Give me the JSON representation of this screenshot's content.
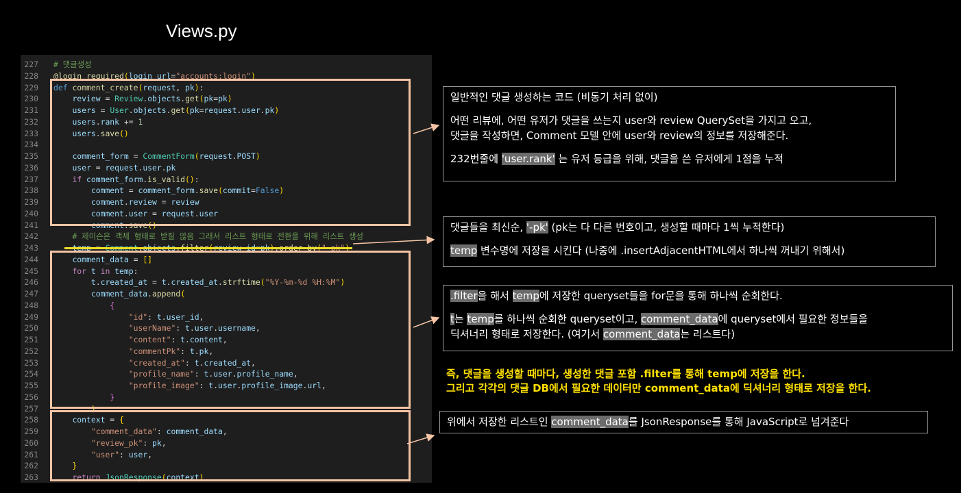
{
  "title": "Views.py",
  "code_lines": [
    {
      "n": "227",
      "i": 1,
      "t": [
        [
          "cmt",
          "# 댓글생성"
        ]
      ]
    },
    {
      "n": "228",
      "i": 1,
      "t": [
        [
          "fn",
          "@login_required"
        ],
        [
          "br1",
          "("
        ],
        [
          "var",
          "login_url"
        ],
        [
          "plain",
          "="
        ],
        [
          "str",
          "\"accounts:login\""
        ],
        [
          "br1",
          ")"
        ]
      ]
    },
    {
      "n": "229",
      "i": 0,
      "t": [
        [
          "kw",
          "def "
        ],
        [
          "fn",
          "comment_create"
        ],
        [
          "br1",
          "("
        ],
        [
          "var",
          "request"
        ],
        [
          "plain",
          ", "
        ],
        [
          "var",
          "pk"
        ],
        [
          "br1",
          ")"
        ],
        [
          "plain",
          ":"
        ]
      ]
    },
    {
      "n": "230",
      "i": 2,
      "t": [
        [
          "var",
          "review"
        ],
        [
          "plain",
          " = "
        ],
        [
          "cls",
          "Review"
        ],
        [
          "plain",
          "."
        ],
        [
          "var",
          "objects"
        ],
        [
          "plain",
          "."
        ],
        [
          "fn",
          "get"
        ],
        [
          "br1",
          "("
        ],
        [
          "var",
          "pk"
        ],
        [
          "plain",
          "="
        ],
        [
          "var",
          "pk"
        ],
        [
          "br1",
          ")"
        ]
      ]
    },
    {
      "n": "231",
      "i": 2,
      "t": [
        [
          "var",
          "users"
        ],
        [
          "plain",
          " = "
        ],
        [
          "cls",
          "User"
        ],
        [
          "plain",
          "."
        ],
        [
          "var",
          "objects"
        ],
        [
          "plain",
          "."
        ],
        [
          "fn",
          "get"
        ],
        [
          "br1",
          "("
        ],
        [
          "var",
          "pk"
        ],
        [
          "plain",
          "="
        ],
        [
          "var",
          "request"
        ],
        [
          "plain",
          "."
        ],
        [
          "var",
          "user"
        ],
        [
          "plain",
          "."
        ],
        [
          "var",
          "pk"
        ],
        [
          "br1",
          ")"
        ]
      ]
    },
    {
      "n": "232",
      "i": 2,
      "t": [
        [
          "var",
          "users"
        ],
        [
          "plain",
          "."
        ],
        [
          "var",
          "rank"
        ],
        [
          "plain",
          " += "
        ],
        [
          "num",
          "1"
        ]
      ]
    },
    {
      "n": "233",
      "i": 2,
      "t": [
        [
          "var",
          "users"
        ],
        [
          "plain",
          "."
        ],
        [
          "fn",
          "save"
        ],
        [
          "br1",
          "()"
        ]
      ]
    },
    {
      "n": "234",
      "i": 0,
      "t": []
    },
    {
      "n": "235",
      "i": 2,
      "t": [
        [
          "var",
          "comment_form"
        ],
        [
          "plain",
          " = "
        ],
        [
          "cls",
          "CommentForm"
        ],
        [
          "br1",
          "("
        ],
        [
          "var",
          "request"
        ],
        [
          "plain",
          "."
        ],
        [
          "var",
          "POST"
        ],
        [
          "br1",
          ")"
        ]
      ]
    },
    {
      "n": "236",
      "i": 2,
      "t": [
        [
          "var",
          "user"
        ],
        [
          "plain",
          " = "
        ],
        [
          "var",
          "request"
        ],
        [
          "plain",
          "."
        ],
        [
          "var",
          "user"
        ],
        [
          "plain",
          "."
        ],
        [
          "var",
          "pk"
        ]
      ]
    },
    {
      "n": "237",
      "i": 2,
      "t": [
        [
          "kw2",
          "if "
        ],
        [
          "var",
          "comment_form"
        ],
        [
          "plain",
          "."
        ],
        [
          "fn",
          "is_valid"
        ],
        [
          "br1",
          "()"
        ],
        [
          "plain",
          ":"
        ]
      ]
    },
    {
      "n": "238",
      "i": 3,
      "t": [
        [
          "var",
          "comment"
        ],
        [
          "plain",
          " = "
        ],
        [
          "var",
          "comment_form"
        ],
        [
          "plain",
          "."
        ],
        [
          "fn",
          "save"
        ],
        [
          "br1",
          "("
        ],
        [
          "var",
          "commit"
        ],
        [
          "plain",
          "="
        ],
        [
          "kw",
          "False"
        ],
        [
          "br1",
          ")"
        ]
      ]
    },
    {
      "n": "239",
      "i": 3,
      "t": [
        [
          "var",
          "comment"
        ],
        [
          "plain",
          "."
        ],
        [
          "var",
          "review"
        ],
        [
          "plain",
          " = "
        ],
        [
          "var",
          "review"
        ]
      ]
    },
    {
      "n": "240",
      "i": 3,
      "t": [
        [
          "var",
          "comment"
        ],
        [
          "plain",
          "."
        ],
        [
          "var",
          "user"
        ],
        [
          "plain",
          " = "
        ],
        [
          "var",
          "request"
        ],
        [
          "plain",
          "."
        ],
        [
          "var",
          "user"
        ]
      ]
    },
    {
      "n": "241",
      "i": 3,
      "t": [
        [
          "var",
          "comment"
        ],
        [
          "plain",
          "."
        ],
        [
          "fn",
          "save"
        ],
        [
          "br1",
          "()"
        ]
      ]
    },
    {
      "n": "242",
      "i": 2,
      "t": [
        [
          "cmt",
          "# 제이슨은 객체 형태로 받질 않음 그래서 리스트 형태로 전환을 위해 리스트 생성"
        ]
      ]
    },
    {
      "n": "243",
      "i": 2,
      "t": [
        [
          "var",
          "temp"
        ],
        [
          "plain",
          " = "
        ],
        [
          "cls",
          "Comment"
        ],
        [
          "plain",
          "."
        ],
        [
          "var",
          "objects"
        ],
        [
          "plain",
          "."
        ],
        [
          "fn",
          "filter"
        ],
        [
          "br1",
          "("
        ],
        [
          "var",
          "review_id"
        ],
        [
          "plain",
          "="
        ],
        [
          "var",
          "pk"
        ],
        [
          "br1",
          ")"
        ],
        [
          "plain",
          "."
        ],
        [
          "fn",
          "order_by"
        ],
        [
          "br1",
          "("
        ],
        [
          "str",
          "\"-pk\""
        ],
        [
          "br1",
          ")"
        ]
      ]
    },
    {
      "n": "244",
      "i": 2,
      "t": [
        [
          "var",
          "comment_data"
        ],
        [
          "plain",
          " = "
        ],
        [
          "br1",
          "[]"
        ]
      ]
    },
    {
      "n": "245",
      "i": 2,
      "t": [
        [
          "kw2",
          "for "
        ],
        [
          "var",
          "t"
        ],
        [
          "kw2",
          " in "
        ],
        [
          "var",
          "temp"
        ],
        [
          "plain",
          ":"
        ]
      ]
    },
    {
      "n": "246",
      "i": 3,
      "t": [
        [
          "var",
          "t"
        ],
        [
          "plain",
          "."
        ],
        [
          "var",
          "created_at"
        ],
        [
          "plain",
          " = "
        ],
        [
          "var",
          "t"
        ],
        [
          "plain",
          "."
        ],
        [
          "var",
          "created_at"
        ],
        [
          "plain",
          "."
        ],
        [
          "fn",
          "strftime"
        ],
        [
          "br1",
          "("
        ],
        [
          "str",
          "\"%Y-%m-%d %H:%M\""
        ],
        [
          "br1",
          ")"
        ]
      ]
    },
    {
      "n": "247",
      "i": 3,
      "t": [
        [
          "var",
          "comment_data"
        ],
        [
          "plain",
          "."
        ],
        [
          "fn",
          "append"
        ],
        [
          "br1",
          "("
        ]
      ]
    },
    {
      "n": "248",
      "i": 4,
      "t": [
        [
          "br2",
          "{"
        ]
      ]
    },
    {
      "n": "249",
      "i": 5,
      "t": [
        [
          "str",
          "\"id\""
        ],
        [
          "plain",
          ": "
        ],
        [
          "var",
          "t"
        ],
        [
          "plain",
          "."
        ],
        [
          "var",
          "user_id"
        ],
        [
          "plain",
          ","
        ]
      ]
    },
    {
      "n": "250",
      "i": 5,
      "t": [
        [
          "str",
          "\"userName\""
        ],
        [
          "plain",
          ": "
        ],
        [
          "var",
          "t"
        ],
        [
          "plain",
          "."
        ],
        [
          "var",
          "user"
        ],
        [
          "plain",
          "."
        ],
        [
          "var",
          "username"
        ],
        [
          "plain",
          ","
        ]
      ]
    },
    {
      "n": "251",
      "i": 5,
      "t": [
        [
          "str",
          "\"content\""
        ],
        [
          "plain",
          ": "
        ],
        [
          "var",
          "t"
        ],
        [
          "plain",
          "."
        ],
        [
          "var",
          "content"
        ],
        [
          "plain",
          ","
        ]
      ]
    },
    {
      "n": "252",
      "i": 5,
      "t": [
        [
          "str",
          "\"commentPk\""
        ],
        [
          "plain",
          ": "
        ],
        [
          "var",
          "t"
        ],
        [
          "plain",
          "."
        ],
        [
          "var",
          "pk"
        ],
        [
          "plain",
          ","
        ]
      ]
    },
    {
      "n": "253",
      "i": 5,
      "t": [
        [
          "str",
          "\"created_at\""
        ],
        [
          "plain",
          ": "
        ],
        [
          "var",
          "t"
        ],
        [
          "plain",
          "."
        ],
        [
          "var",
          "created_at"
        ],
        [
          "plain",
          ","
        ]
      ]
    },
    {
      "n": "254",
      "i": 5,
      "t": [
        [
          "str",
          "\"profile_name\""
        ],
        [
          "plain",
          ": "
        ],
        [
          "var",
          "t"
        ],
        [
          "plain",
          "."
        ],
        [
          "var",
          "user"
        ],
        [
          "plain",
          "."
        ],
        [
          "var",
          "profile_name"
        ],
        [
          "plain",
          ","
        ]
      ]
    },
    {
      "n": "255",
      "i": 5,
      "t": [
        [
          "str",
          "\"profile_image\""
        ],
        [
          "plain",
          ": "
        ],
        [
          "var",
          "t"
        ],
        [
          "plain",
          "."
        ],
        [
          "var",
          "user"
        ],
        [
          "plain",
          "."
        ],
        [
          "var",
          "profile_image"
        ],
        [
          "plain",
          "."
        ],
        [
          "var",
          "url"
        ],
        [
          "plain",
          ","
        ]
      ]
    },
    {
      "n": "256",
      "i": 4,
      "t": [
        [
          "br2",
          "}"
        ]
      ]
    },
    {
      "n": "257",
      "i": 3,
      "t": [
        [
          "br1",
          ")"
        ]
      ]
    },
    {
      "n": "258",
      "i": 2,
      "t": [
        [
          "var",
          "context"
        ],
        [
          "plain",
          " = "
        ],
        [
          "br1",
          "{"
        ]
      ]
    },
    {
      "n": "259",
      "i": 3,
      "t": [
        [
          "str",
          "\"comment_data\""
        ],
        [
          "plain",
          ": "
        ],
        [
          "var",
          "comment_data"
        ],
        [
          "plain",
          ","
        ]
      ]
    },
    {
      "n": "260",
      "i": 3,
      "t": [
        [
          "str",
          "\"review_pk\""
        ],
        [
          "plain",
          ": "
        ],
        [
          "var",
          "pk"
        ],
        [
          "plain",
          ","
        ]
      ]
    },
    {
      "n": "261",
      "i": 3,
      "t": [
        [
          "str",
          "\"user\""
        ],
        [
          "plain",
          ": "
        ],
        [
          "var",
          "user"
        ],
        [
          "plain",
          ","
        ]
      ]
    },
    {
      "n": "262",
      "i": 2,
      "t": [
        [
          "br1",
          "}"
        ]
      ]
    },
    {
      "n": "263",
      "i": 2,
      "t": [
        [
          "kw2",
          "return "
        ],
        [
          "cls",
          "JsonResponse"
        ],
        [
          "br1",
          "("
        ],
        [
          "var",
          "context"
        ],
        [
          "br1",
          ")"
        ]
      ]
    }
  ],
  "notes": {
    "n1": {
      "l1": "일반적인 댓글 생성하는 코드 (비동기 처리 없이)",
      "l2": "어떤 리뷰에, 어떤 유저가 댓글을 쓰는지 user와 review QuerySet을 가지고 오고,",
      "l3": "댓글을 작성하면, Comment 모델 안에 user와 review의 정보를 저장해준다.",
      "l4a": "232번줄에 ",
      "l4tag": "'user.rank'",
      "l4b": " 는 유저 등급을 위해, 댓글을 쓴 유저에게 1점을 누적"
    },
    "n2": {
      "l1a": "댓글들을 최신순, ",
      "l1tag": "'-pk'",
      "l1b": " (pk는 다 다른 번호이고, 생성할 때마다 1씩 누적한다)",
      "l2tag": "temp",
      "l2b": " 변수명에 저장을 시킨다 (나중에 .insertAdjacentHTML에서 하나씩 꺼내기 위해서)"
    },
    "n3": {
      "l1tag": ".filter",
      "l1b": "을 해서 ",
      "l1tag2": "temp",
      "l1c": "에 저장한 queryset들을 for문을 통해 하나씩 순회한다.",
      "l2tag": "t",
      "l2b": "는 ",
      "l2tag2": "temp",
      "l2c": "를 하나씩 순회한 queryset이고, ",
      "l2tag3": "comment_data",
      "l2d": "에  queryset에서 필요한 정보들을",
      "l3a": "딕셔너리 형태로 저장한다. (여기서 ",
      "l3tag": "comment_data",
      "l3b": "는 리스트다)"
    },
    "n4": {
      "l1a": "위에서 저장한 리스트인 ",
      "l1tag": "comment_data",
      "l1b": "를 JsonResponse를 통해 JavaScript로 넘겨준다"
    }
  },
  "summary": {
    "l1": "즉, 댓글을 생성할 때마다, 생성한 댓글 포함 .filter를 통해 temp에 저장을 한다.",
    "l2": "그리고 각각의 댓글 DB에서 필요한 데이터만 comment_data에 딕셔너리 형태로 저장을 한다."
  },
  "colors": {
    "highlight_box": "#f4c4a4",
    "underline": "#f0e028",
    "summary_text": "#ffe000",
    "note_border": "#9a9a9a",
    "code_bg": "#1e1e1e"
  }
}
